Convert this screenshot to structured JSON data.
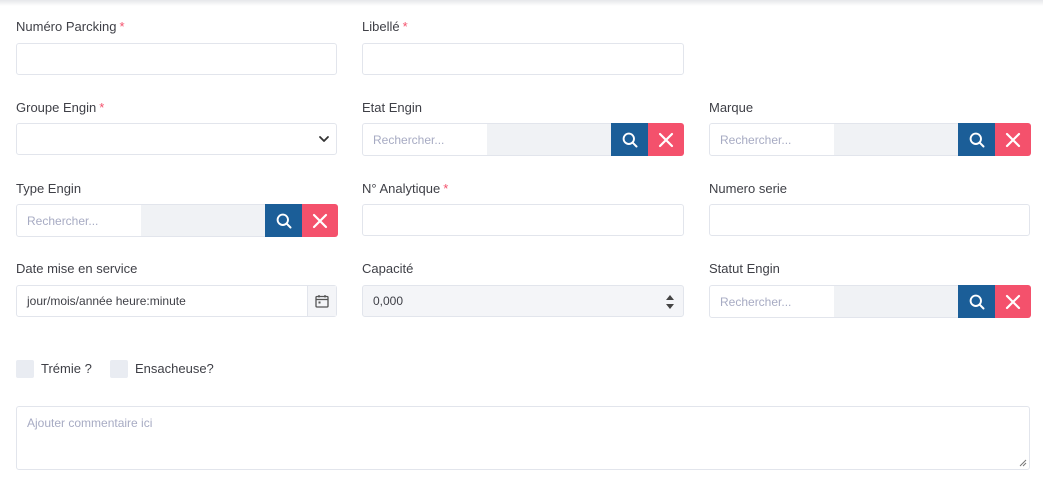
{
  "fields": {
    "numero_parcking": {
      "label": "Numéro Parcking",
      "required": "*",
      "value": ""
    },
    "libelle": {
      "label": "Libellé",
      "required": "*",
      "value": ""
    },
    "groupe_engin": {
      "label": "Groupe Engin",
      "required": "*",
      "selected": ""
    },
    "etat_engin": {
      "label": "Etat Engin",
      "placeholder": "Rechercher..."
    },
    "marque": {
      "label": "Marque",
      "placeholder": "Rechercher..."
    },
    "type_engin": {
      "label": "Type Engin",
      "placeholder": "Rechercher..."
    },
    "n_analytique": {
      "label": "N° Analytique",
      "required": "*",
      "value": ""
    },
    "numero_serie": {
      "label": "Numero serie",
      "value": ""
    },
    "date_mise_en_service": {
      "label": "Date mise en service",
      "value": "jour/mois/année heure:minute"
    },
    "capacite": {
      "label": "Capacité",
      "value": "0,000"
    },
    "statut_engin": {
      "label": "Statut Engin",
      "placeholder": "Rechercher..."
    }
  },
  "checkboxes": {
    "tremie": {
      "label": "Trémie ?",
      "checked": false
    },
    "ensacheuse": {
      "label": "Ensacheuse?",
      "checked": false
    }
  },
  "comment": {
    "placeholder": "Ajouter commentaire ici"
  },
  "colors": {
    "search_button": "#1b5e98",
    "clear_button": "#f4516c",
    "required_mark": "#f4516c"
  },
  "icons": {
    "search": "search-icon",
    "clear": "close-icon",
    "calendar": "calendar-icon",
    "select": "chevron-down-icon"
  }
}
